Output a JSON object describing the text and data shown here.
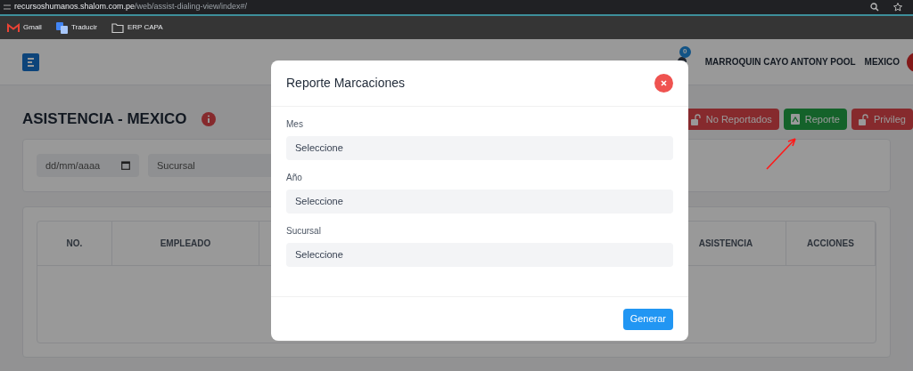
{
  "browser": {
    "url_host": "recursoshumanos.shalom.com.pe",
    "url_path": "/web/assist-dialing-view/index#/",
    "bookmarks": [
      {
        "kind": "gmail",
        "label": "Gmail"
      },
      {
        "kind": "translate",
        "label": "Traducir"
      },
      {
        "kind": "folder",
        "label": "ERP CAPA"
      }
    ]
  },
  "header": {
    "notification_count": "0",
    "user": "MARROQUIN CAYO ANTONY POOL",
    "country": "MEXICO"
  },
  "page": {
    "title": "ASISTENCIA - MEXICO",
    "actions": [
      {
        "kind": "danger",
        "label": "No Reportados"
      },
      {
        "kind": "success",
        "label": "Reporte"
      },
      {
        "kind": "danger",
        "label": "Privileg"
      }
    ],
    "filters": {
      "date_placeholder": "dd/mm/aaaa",
      "branch": "Sucursal"
    },
    "table": {
      "columns": [
        "NO.",
        "EMPLEADO",
        "ASISTENCIA",
        "ACCIONES"
      ]
    }
  },
  "modal": {
    "title": "Reporte Marcaciones",
    "fields": [
      {
        "label": "Mes",
        "value": "Seleccione"
      },
      {
        "label": "Año",
        "value": "Seleccione"
      },
      {
        "label": "Sucursal",
        "value": "Seleccione"
      }
    ],
    "submit": "Generar"
  }
}
